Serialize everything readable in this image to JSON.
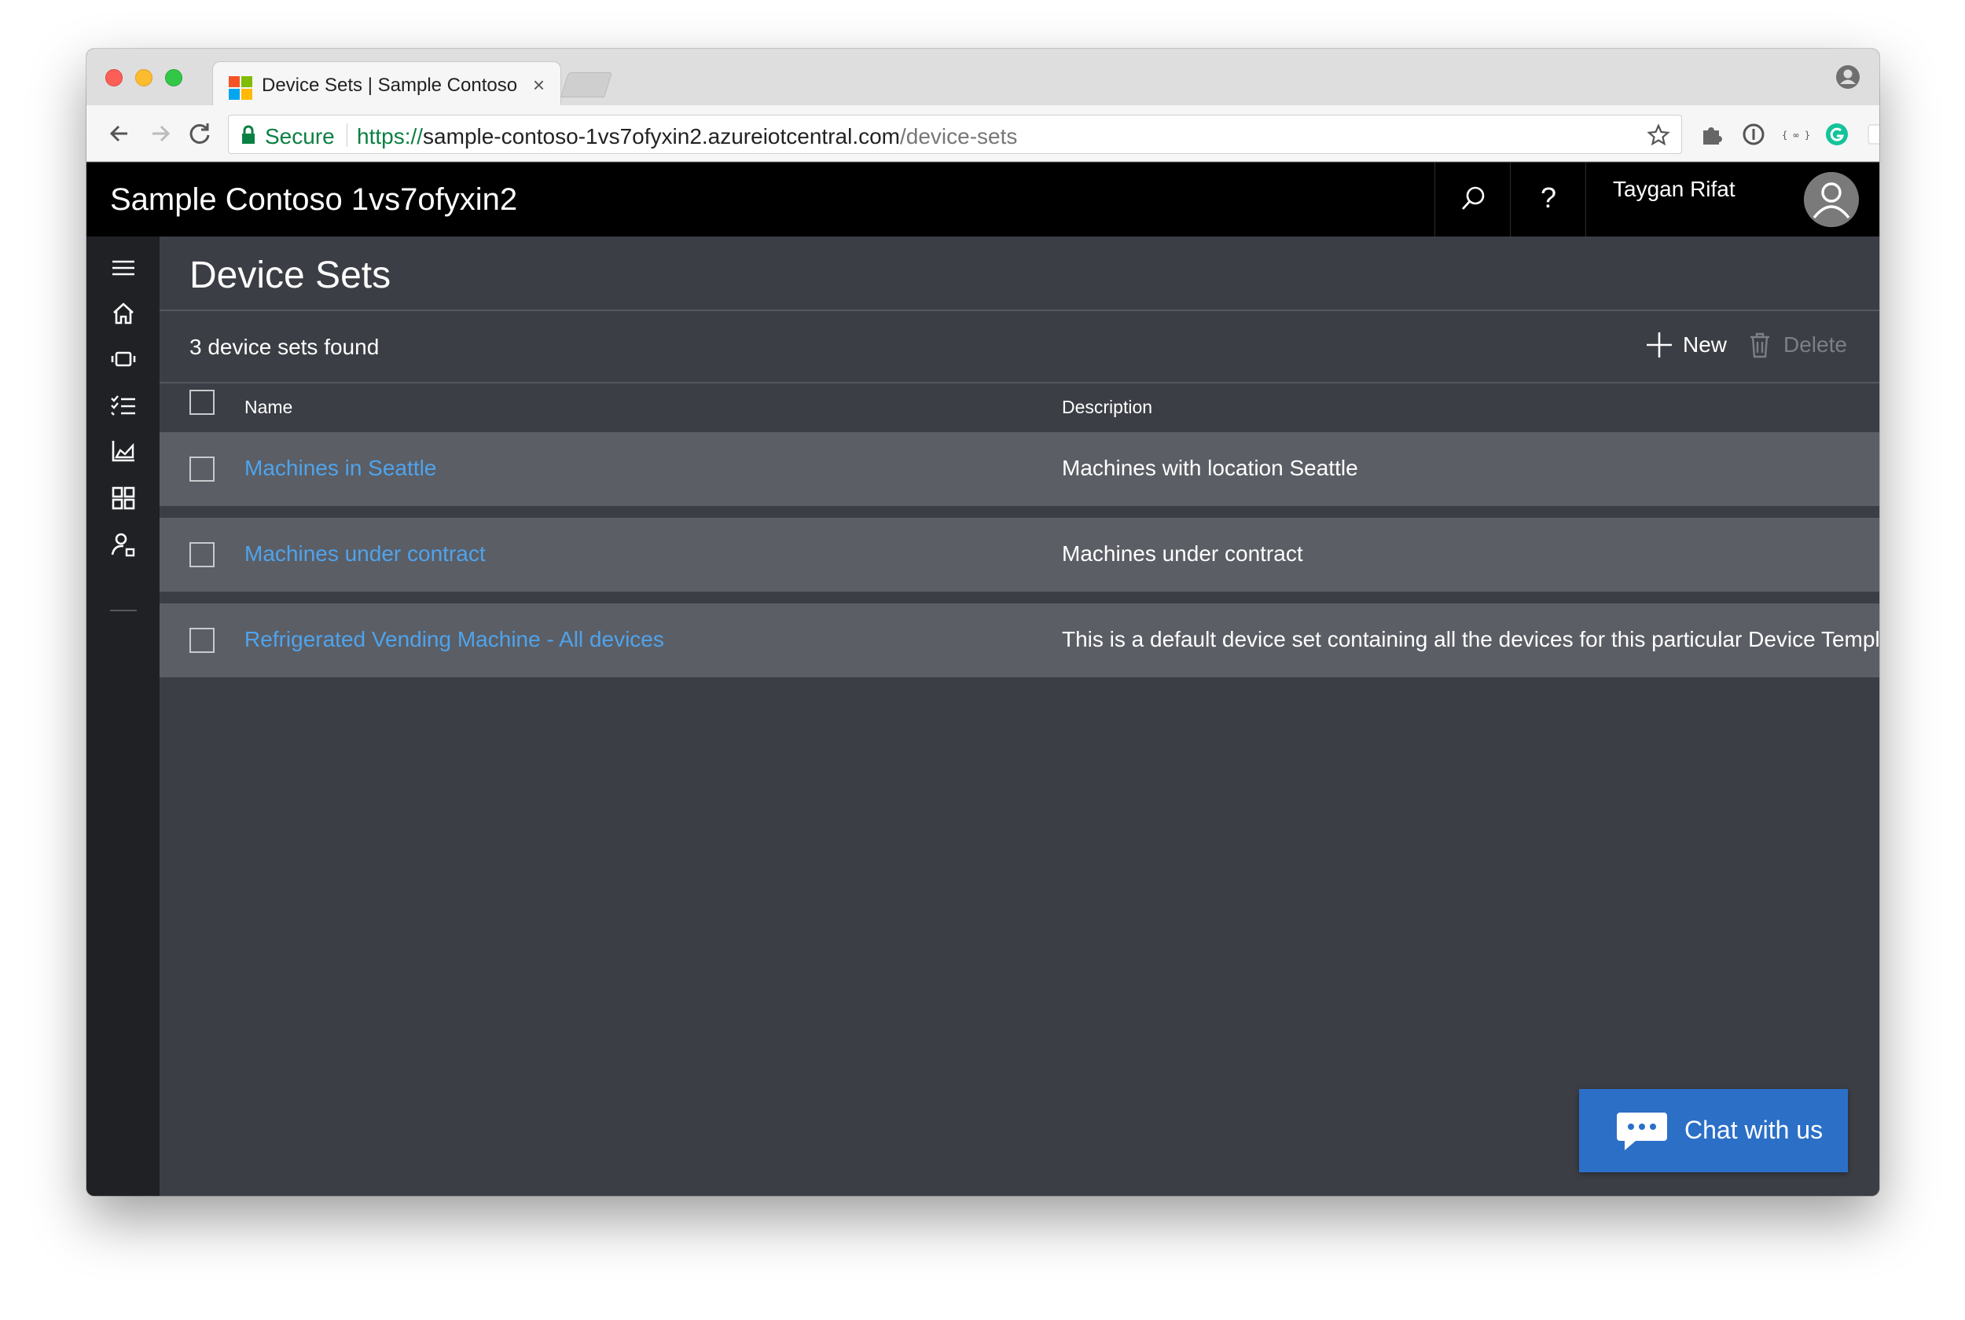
{
  "browser": {
    "tab_title": "Device Sets | Sample Contoso",
    "tab_close": "×",
    "secure_label": "Secure",
    "url": {
      "scheme": "https://",
      "host": "sample-contoso-1vs7ofyxin2.azureiotcentral.com",
      "path": "/device-sets"
    }
  },
  "header": {
    "app_title": "Sample Contoso 1vs7ofyxin2",
    "help_label": "?",
    "user_name": "Taygan Rifat"
  },
  "sidebar": {
    "items": [
      {
        "icon": "menu-icon"
      },
      {
        "icon": "home-icon"
      },
      {
        "icon": "devices-icon"
      },
      {
        "icon": "rules-icon"
      },
      {
        "icon": "analytics-icon"
      },
      {
        "icon": "dashboard-icon"
      },
      {
        "icon": "administration-icon"
      }
    ]
  },
  "page": {
    "title": "Device Sets",
    "count_text": "3 device sets found",
    "actions": {
      "new_label": "New",
      "delete_label": "Delete"
    },
    "table": {
      "columns": [
        "Name",
        "Description"
      ],
      "rows": [
        {
          "name": "Machines in Seattle",
          "description": "Machines with location Seattle"
        },
        {
          "name": "Machines under contract",
          "description": "Machines under contract"
        },
        {
          "name": "Refrigerated Vending Machine - All devices",
          "description": "This is a default device set containing all the devices for this particular Device Template."
        }
      ]
    }
  },
  "chat": {
    "label": "Chat with us"
  },
  "colors": {
    "header_bg": "#000000",
    "sidebar_bg": "#1f2125",
    "main_bg": "#3b3e44",
    "row_bg": "#5b5e65",
    "link": "#4fa3ec",
    "chat_button": "#2b6fc7",
    "secure_green": "#0b8043"
  }
}
